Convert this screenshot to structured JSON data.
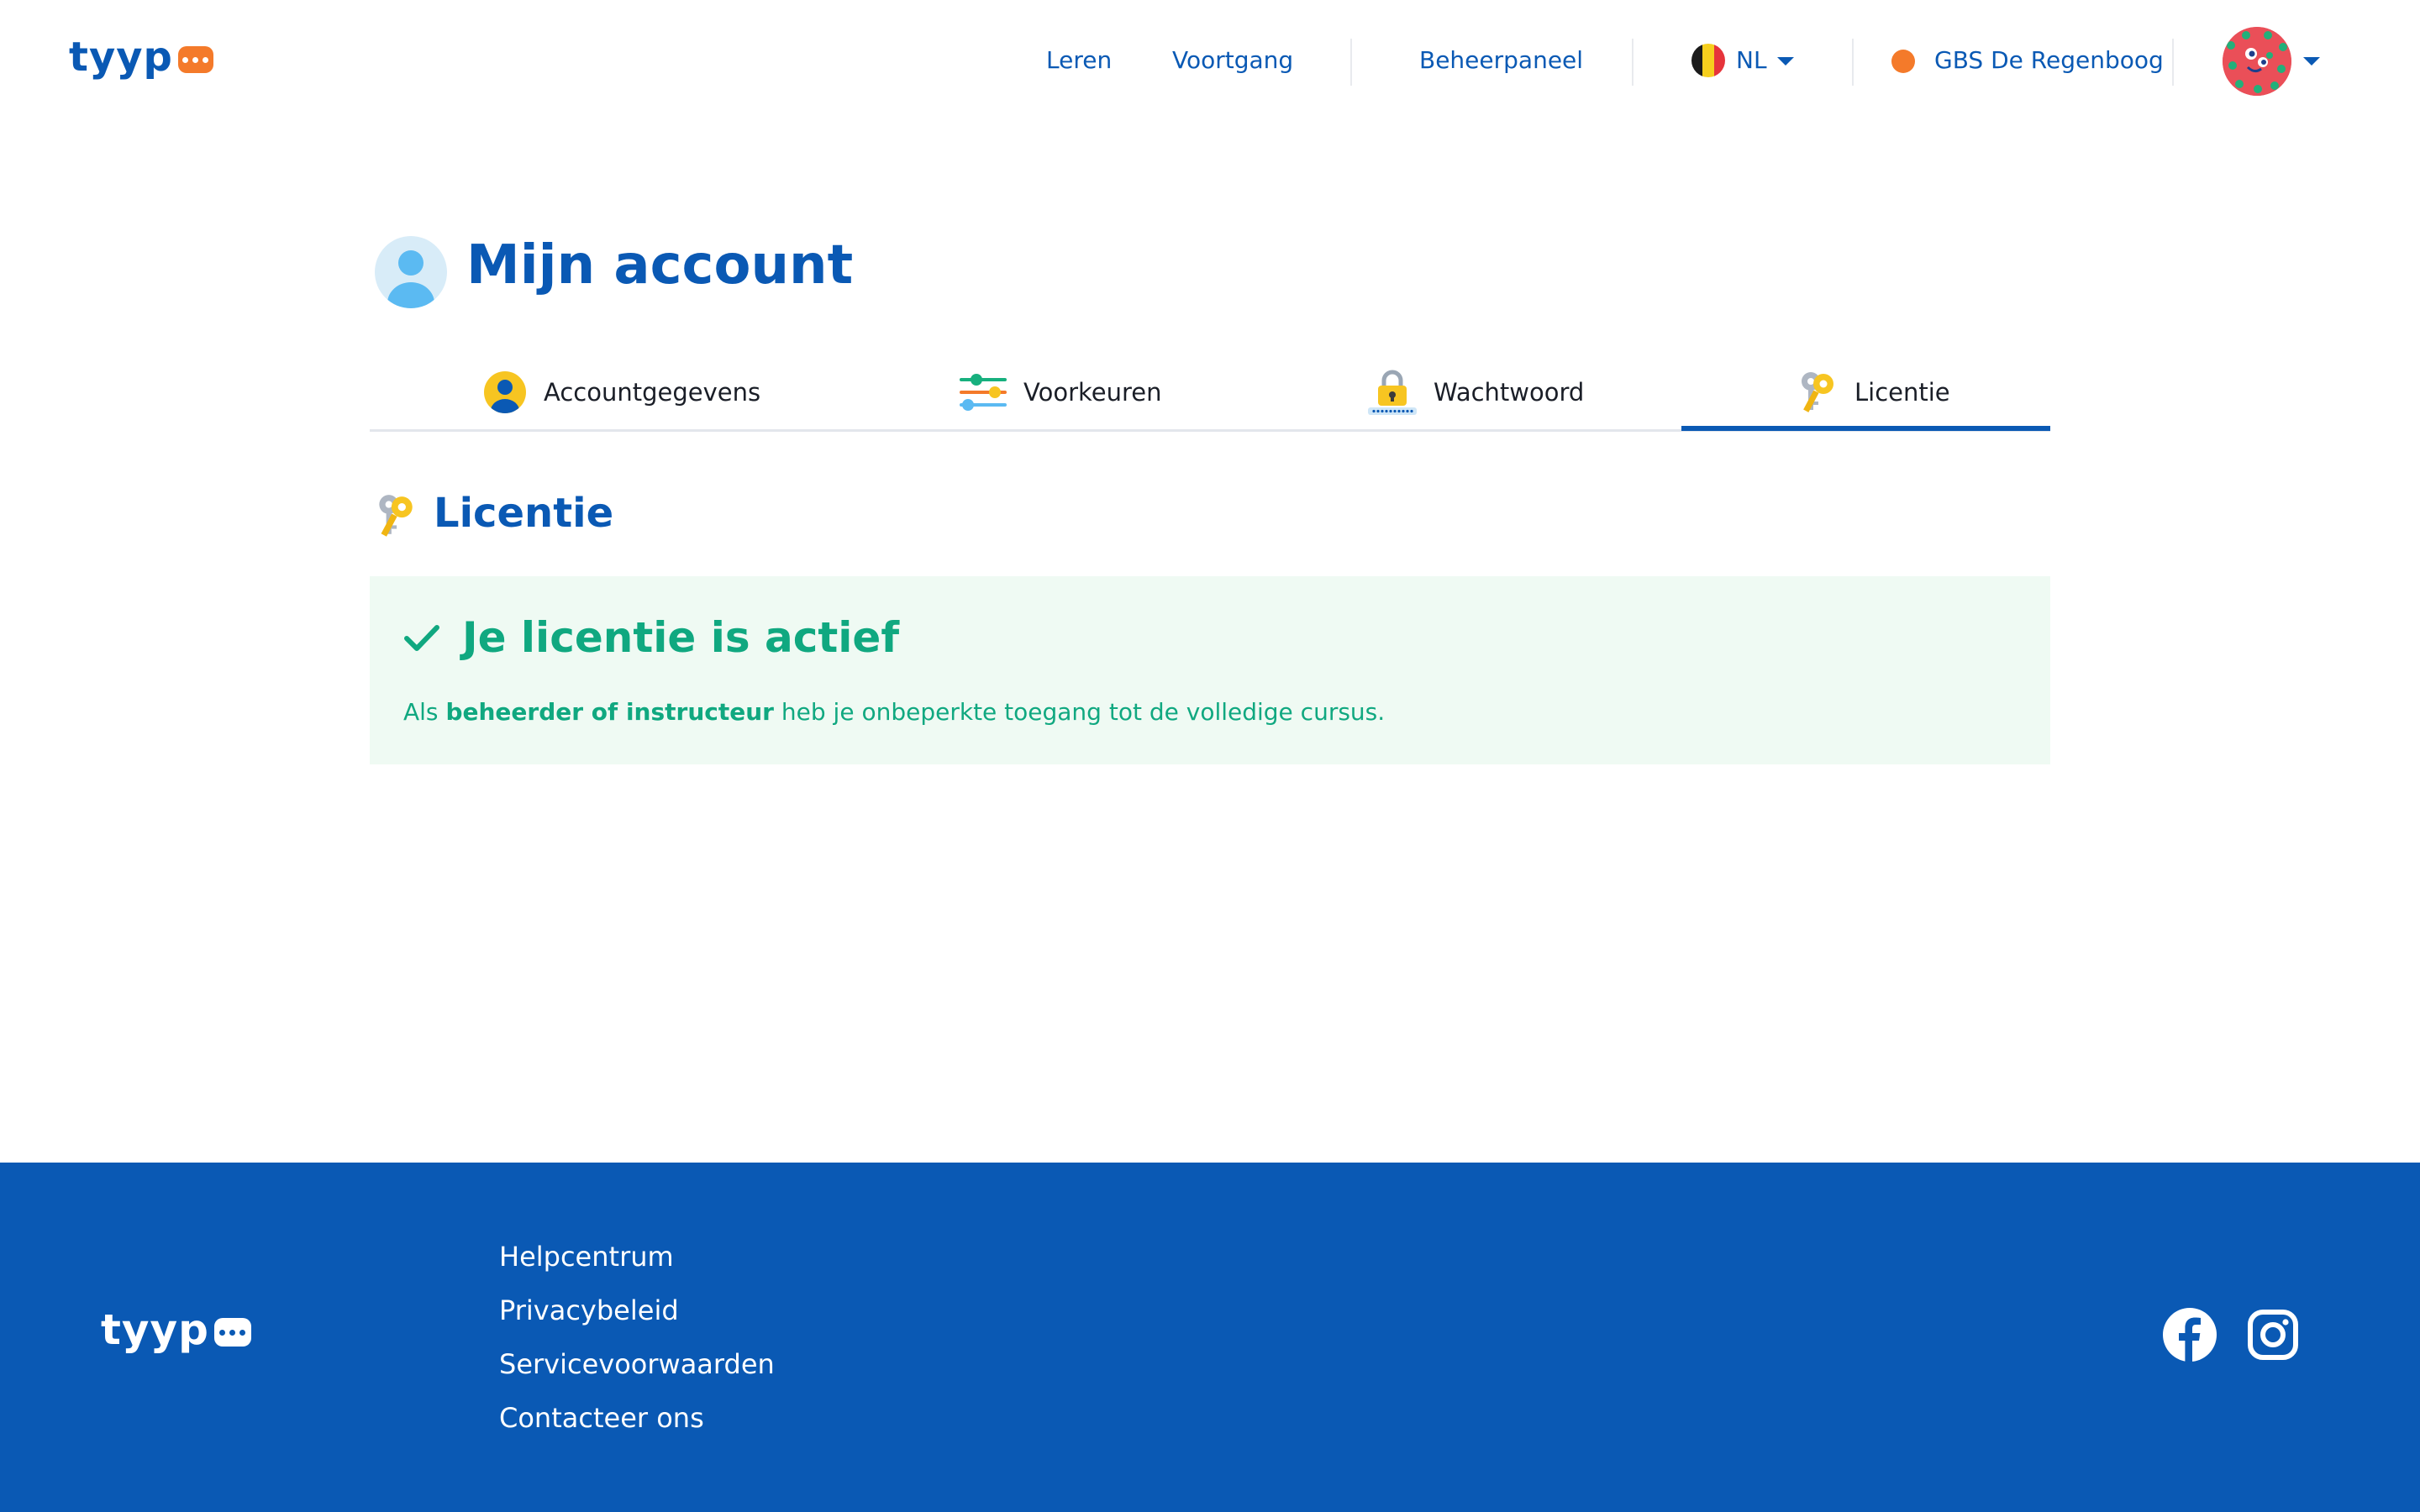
{
  "header": {
    "logo_text": "tyyp",
    "nav": {
      "learn": "Leren",
      "progress": "Voortgang",
      "admin_panel": "Beheerpaneel"
    },
    "language": {
      "code": "NL",
      "flag_icon": "belgium-flag-icon"
    },
    "school": {
      "name": "GBS De Regenboog",
      "dot_color": "#f47a2a"
    },
    "avatar_icon": "user-avatar-icon"
  },
  "page": {
    "title": "Mijn account"
  },
  "tabs": [
    {
      "label": "Accountgegevens",
      "icon": "user-icon",
      "active": false
    },
    {
      "label": "Voorkeuren",
      "icon": "sliders-icon",
      "active": false
    },
    {
      "label": "Wachtwoord",
      "icon": "lock-icon",
      "active": false
    },
    {
      "label": "Licentie",
      "icon": "keys-icon",
      "active": true
    }
  ],
  "license": {
    "section_title": "Licentie",
    "status": "Je licentie is actief",
    "note_prefix": "Als",
    "note_bold": "beheerder of instructeur",
    "note_suffix": "heb je onbeperkte toegang tot de volledige cursus."
  },
  "footer": {
    "logo_text": "tyyp",
    "links": [
      "Helpcentrum",
      "Privacybeleid",
      "Servicevoorwaarden",
      "Contacteer ons"
    ],
    "social": [
      "facebook-icon",
      "instagram-icon"
    ]
  },
  "colors": {
    "brand_blue": "#0a59b4",
    "accent_orange": "#f47a2a",
    "success_green": "#10a880",
    "success_bg": "#effaf3"
  }
}
